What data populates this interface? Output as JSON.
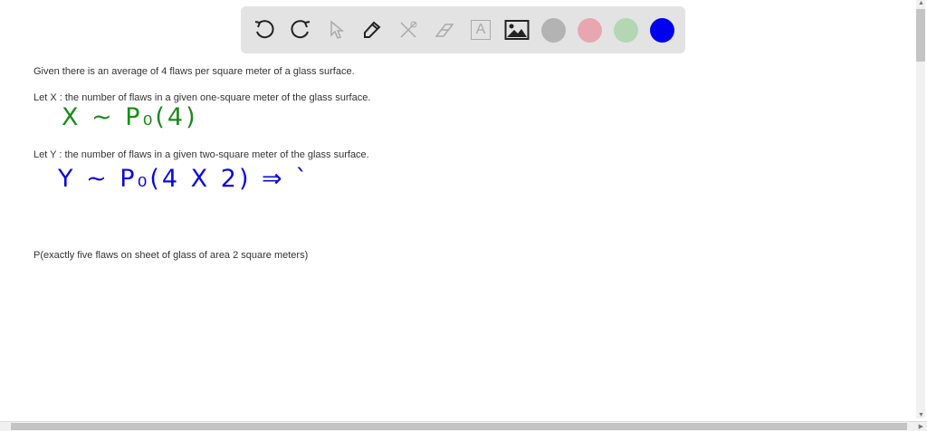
{
  "toolbar": {
    "tools": [
      "undo-icon",
      "redo-icon",
      "pointer-icon",
      "pen-icon",
      "tools-icon",
      "eraser-icon",
      "text-icon",
      "image-icon"
    ],
    "text_tool_glyph": "A",
    "colors": [
      "#b3b3b3",
      "#e8a7b0",
      "#b3d6b3",
      "#0000ee"
    ]
  },
  "content": {
    "line1": "Given there is an average of 4 flaws per square meter of a glass surface.",
    "line2": "Let X : the number of flaws in a given one-square meter of the glass surface.",
    "hand1": "X ~ P₀(4)",
    "line3": "Let Y : the number of flaws in a given two-square meter of the glass surface.",
    "hand2": "Y ~ P₀(4 X 2) ⇒ `",
    "line4": "P(exactly five flaws on sheet of glass of area 2 square meters)"
  },
  "ink_colors": {
    "green": "#1a8a1a",
    "blue": "#0a0ae0"
  }
}
